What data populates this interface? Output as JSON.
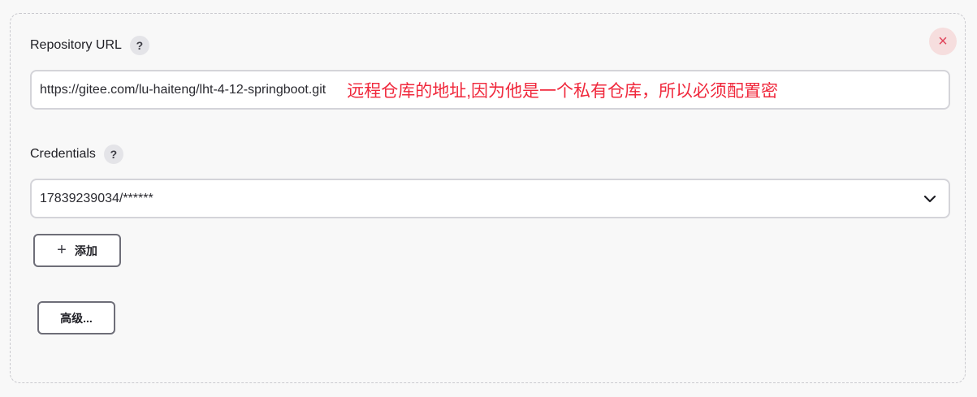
{
  "repository": {
    "label": "Repository URL",
    "help": "?",
    "url_value": "https://gitee.com/lu-haiteng/lht-4-12-springboot.git",
    "annotation": "远程仓库的地址,因为他是一个私有仓库，所以必须配置密"
  },
  "close": {
    "glyph": "×"
  },
  "credentials": {
    "label": "Credentials",
    "help": "?",
    "selected": "17839239034/******"
  },
  "buttons": {
    "add_icon": "+",
    "add_label": "添加",
    "advanced_label": "高级..."
  }
}
